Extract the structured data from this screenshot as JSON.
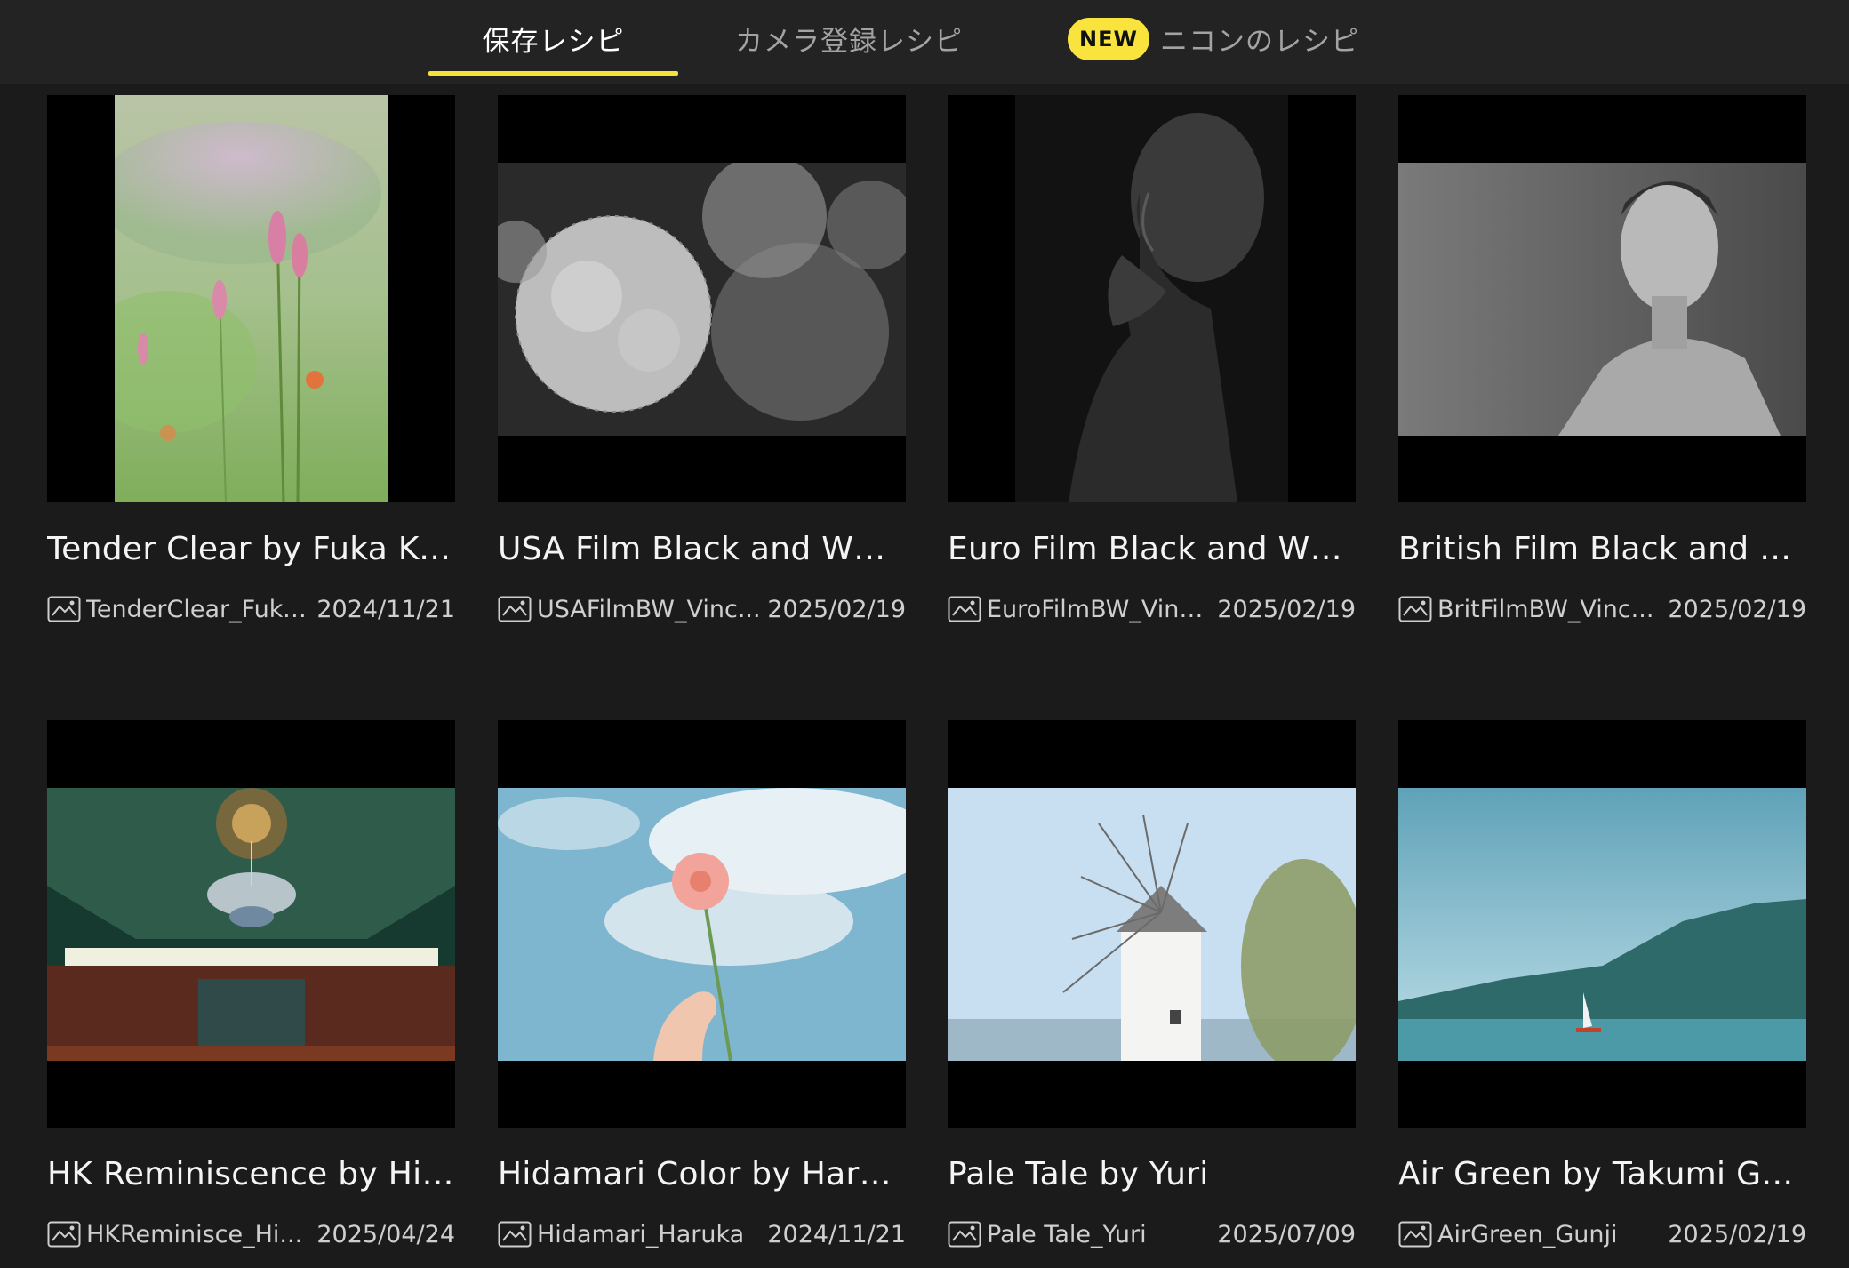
{
  "tabs": [
    {
      "label": "保存レシピ"
    },
    {
      "label": "カメラ登録レシピ"
    },
    {
      "label": "ニコンのレシピ",
      "badge": "NEW"
    }
  ],
  "recipes": [
    {
      "title": "Tender Clear by Fuka Ka...",
      "file": "TenderClear_FukaK",
      "date": "2024/11/21",
      "thumb_icon": "flower-photo"
    },
    {
      "title": "USA Film Black and Whit...",
      "file": "USAFilmBW_Vinc...",
      "date": "2025/02/19",
      "thumb_icon": "hydrangea-photo"
    },
    {
      "title": "Euro Film Black and Whit...",
      "file": "EuroFilmBW_Vinc...",
      "date": "2025/02/19",
      "thumb_icon": "portrait-photo"
    },
    {
      "title": "British Film Black and W...",
      "file": "BritFilmBW_Vinc...",
      "date": "2025/02/19",
      "thumb_icon": "portrait-photo"
    },
    {
      "title": "HK Reminiscence by Hiu...",
      "file": "HKReminisce_Hi...",
      "date": "2025/04/24",
      "thumb_icon": "ceiling-photo"
    },
    {
      "title": "Hidamari Color by Haruk...",
      "file": "Hidamari_Haruka",
      "date": "2024/11/21",
      "thumb_icon": "flower-sky-photo"
    },
    {
      "title": "Pale Tale by Yuri",
      "file": "Pale Tale_Yuri",
      "date": "2025/07/09",
      "thumb_icon": "windmill-photo"
    },
    {
      "title": "Air Green by Takumi Gunji",
      "file": "AirGreen_Gunji",
      "date": "2025/02/19",
      "thumb_icon": "lake-photo"
    }
  ]
}
